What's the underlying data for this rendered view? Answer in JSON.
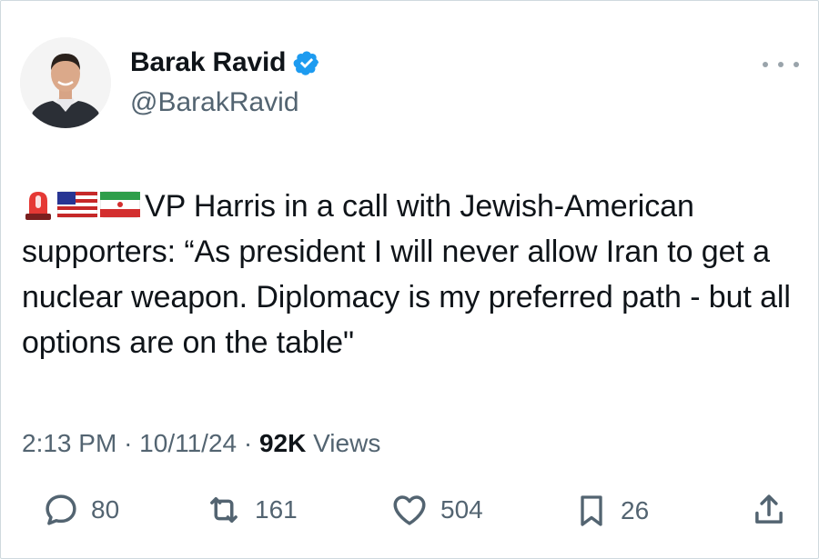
{
  "author": {
    "display_name": "Barak Ravid",
    "handle": "@BarakRavid",
    "verified": true,
    "accent_color": "#1d9bf0"
  },
  "tweet": {
    "emojis": [
      "rotating-light-emoji",
      "us-flag-emoji",
      "iran-flag-emoji"
    ],
    "text": "VP Harris in a call with Jewish-American supporters: “As president I will never allow Iran to get a nuclear weapon. Diplomacy is my preferred path - but all options are on the table\""
  },
  "meta": {
    "time": "2:13 PM",
    "separator": "·",
    "date": "10/11/24",
    "views_count": "92K",
    "views_label": "Views"
  },
  "actions": {
    "replies": "80",
    "reposts": "161",
    "likes": "504",
    "bookmarks": "26"
  },
  "icons": {
    "more": "more-dots-icon",
    "verified": "verified-badge-icon",
    "reply": "reply-icon",
    "repost": "repost-icon",
    "like": "heart-icon",
    "bookmark": "bookmark-icon",
    "share": "share-icon"
  }
}
